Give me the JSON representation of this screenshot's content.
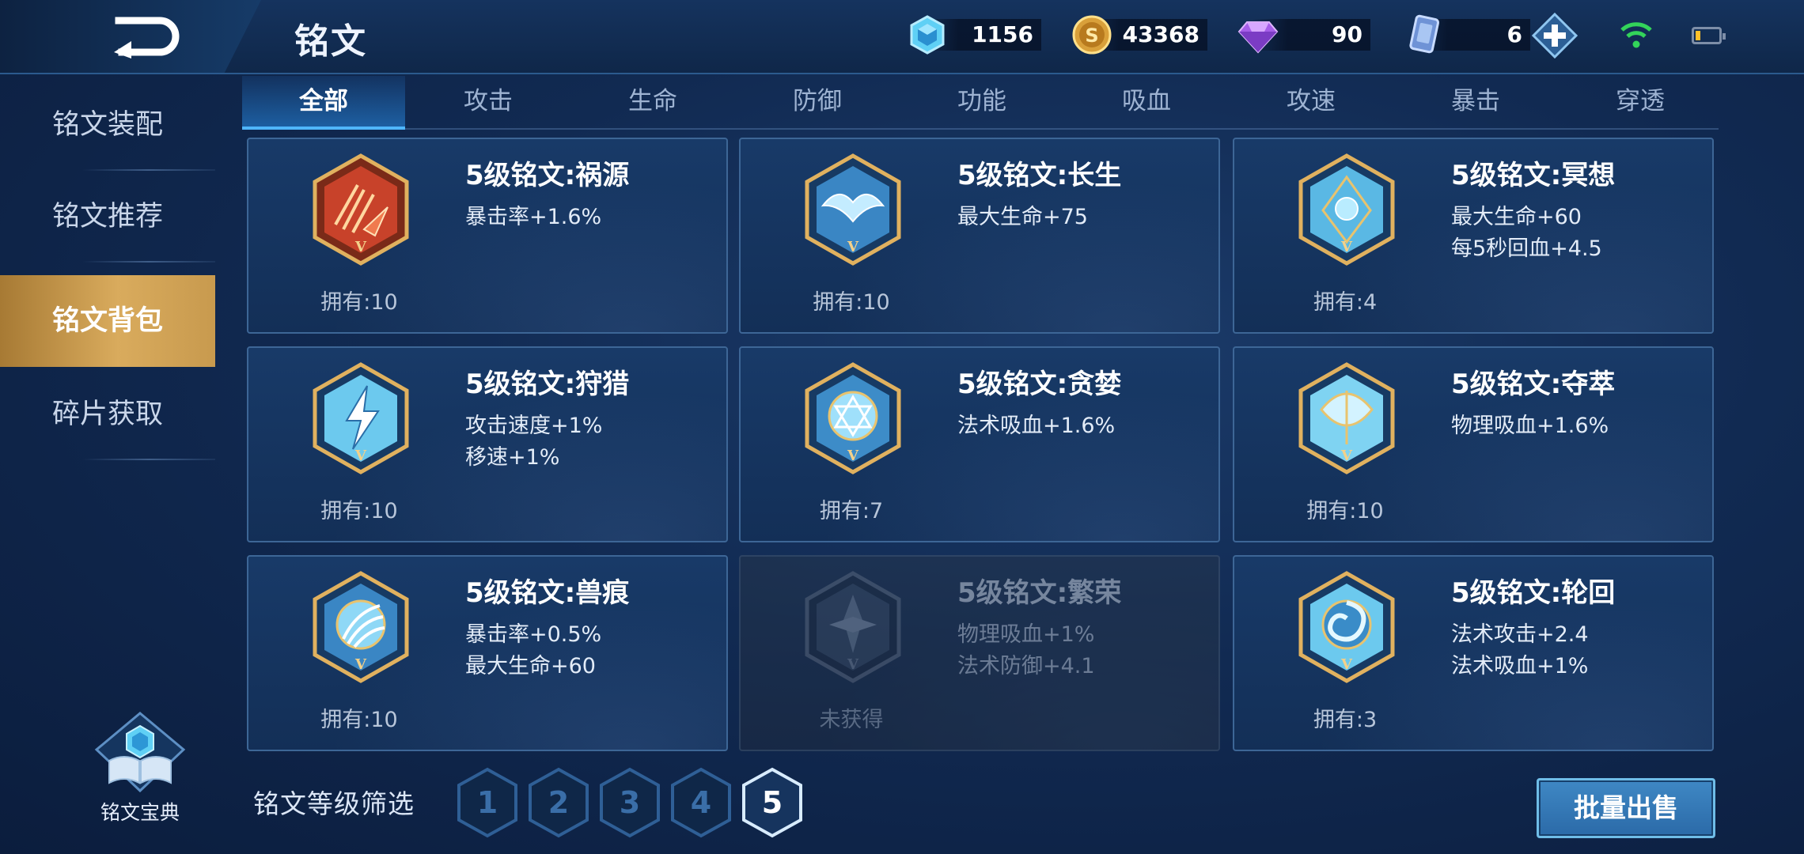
{
  "header": {
    "title": "铭文",
    "resources": [
      {
        "icon": "crystal-icon",
        "value": "1156"
      },
      {
        "icon": "gold-coin-icon",
        "value": "43368"
      },
      {
        "icon": "purple-diamond-icon",
        "value": "90"
      },
      {
        "icon": "ticket-card-icon",
        "value": "6"
      }
    ]
  },
  "sidebar": {
    "items": [
      {
        "label": "铭文装配",
        "active": false
      },
      {
        "label": "铭文推荐",
        "active": false
      },
      {
        "label": "铭文背包",
        "active": true
      },
      {
        "label": "碎片获取",
        "active": false
      }
    ],
    "codex_label": "铭文宝典"
  },
  "tabs": [
    {
      "label": "全部",
      "active": true
    },
    {
      "label": "攻击"
    },
    {
      "label": "生命"
    },
    {
      "label": "防御"
    },
    {
      "label": "功能"
    },
    {
      "label": "吸血"
    },
    {
      "label": "攻速"
    },
    {
      "label": "暴击"
    },
    {
      "label": "穿透"
    }
  ],
  "inscriptions": [
    {
      "name": "5级铭文:祸源",
      "stats": [
        "暴击率+1.6%"
      ],
      "owned": "拥有:10",
      "color": "red"
    },
    {
      "name": "5级铭文:长生",
      "stats": [
        "最大生命+75"
      ],
      "owned": "拥有:10",
      "color": "blue"
    },
    {
      "name": "5级铭文:冥想",
      "stats": [
        "最大生命+60",
        "每5秒回血+4.5"
      ],
      "owned": "拥有:4",
      "color": "blue"
    },
    {
      "name": "5级铭文:狩猎",
      "stats": [
        "攻击速度+1%",
        "移速+1%"
      ],
      "owned": "拥有:10",
      "color": "blue"
    },
    {
      "name": "5级铭文:贪婪",
      "stats": [
        "法术吸血+1.6%"
      ],
      "owned": "拥有:7",
      "color": "blue"
    },
    {
      "name": "5级铭文:夺萃",
      "stats": [
        "物理吸血+1.6%"
      ],
      "owned": "拥有:10",
      "color": "blue"
    },
    {
      "name": "5级铭文:兽痕",
      "stats": [
        "暴击率+0.5%",
        "最大生命+60"
      ],
      "owned": "拥有:10",
      "color": "blue"
    },
    {
      "name": "5级铭文:繁荣",
      "stats": [
        "物理吸血+1%",
        "法术防御+4.1"
      ],
      "owned": "未获得",
      "color": "gray"
    },
    {
      "name": "5级铭文:轮回",
      "stats": [
        "法术攻击+2.4",
        "法术吸血+1%"
      ],
      "owned": "拥有:3",
      "color": "blue"
    }
  ],
  "filter": {
    "label": "铭文等级筛选",
    "levels": [
      "1",
      "2",
      "3",
      "4",
      "5"
    ],
    "selected": "5"
  },
  "sell_button": "批量出售",
  "colors": {
    "accent_gold": "#d9ab5d",
    "accent_blue": "#4fb6ff",
    "red_gem": "#c8422a",
    "blue_gem": "#6cc9ee"
  }
}
